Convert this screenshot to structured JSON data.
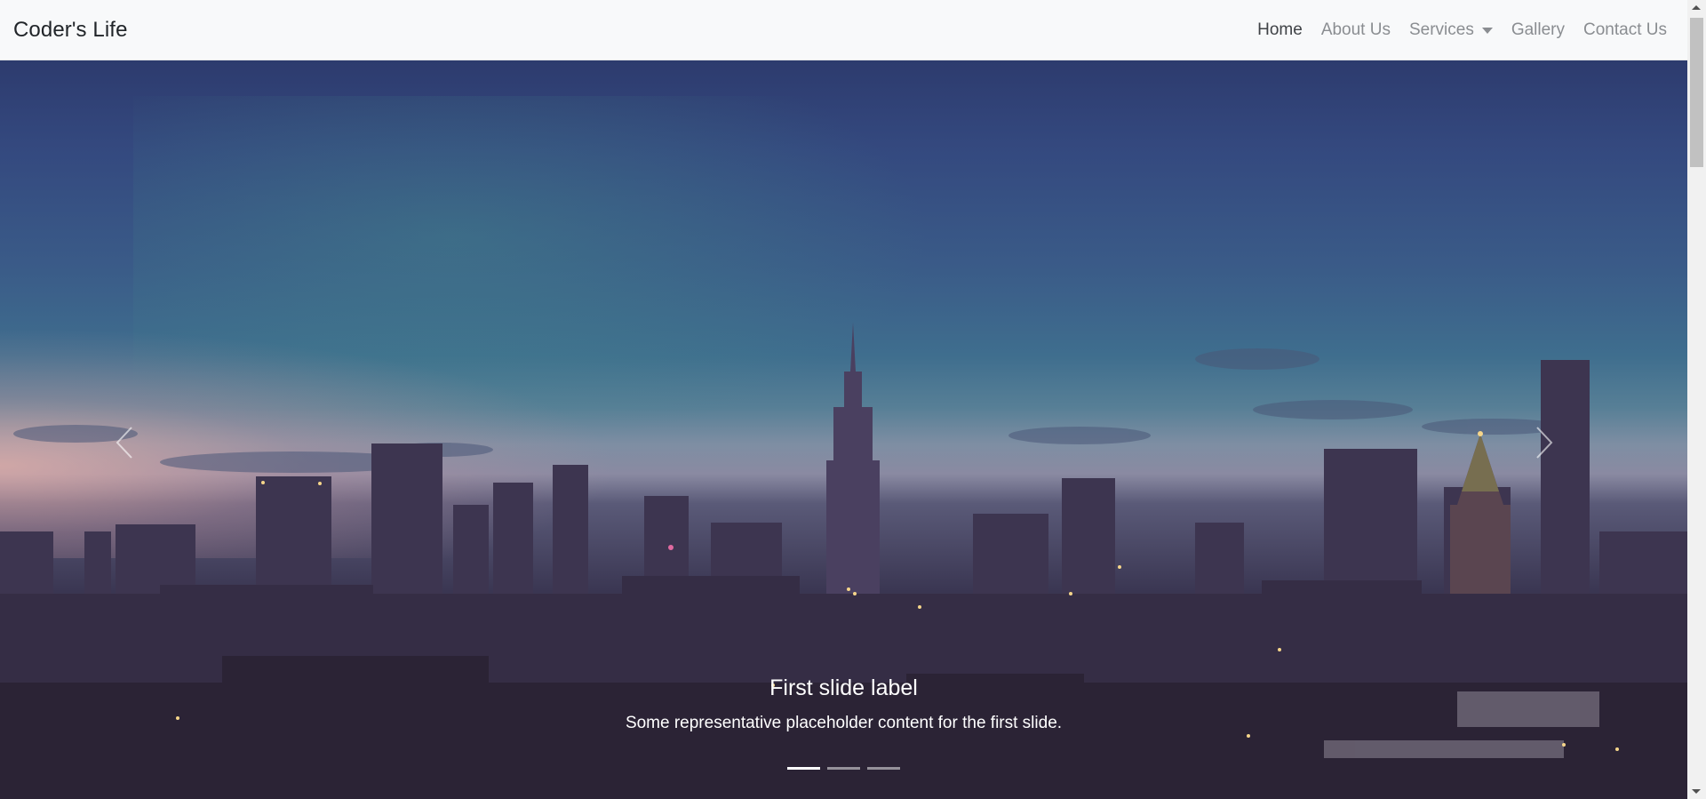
{
  "navbar": {
    "brand": "Coder's Life",
    "links": [
      {
        "label": "Home",
        "active": true
      },
      {
        "label": "About Us",
        "active": false
      },
      {
        "label": "Services",
        "active": false,
        "dropdown": true
      },
      {
        "label": "Gallery",
        "active": false
      },
      {
        "label": "Contact Us",
        "active": false
      }
    ]
  },
  "carousel": {
    "caption_title": "First slide label",
    "caption_text": "Some representative placeholder content for the first slide.",
    "slide_count": 3,
    "active_slide": 1,
    "prev_icon": "chevron-left-icon",
    "next_icon": "chevron-right-icon"
  },
  "colors": {
    "navbar_bg": "#f8f9fa",
    "nav_active": "#3f4246",
    "nav_inactive": "#8a8d91",
    "caption_text": "#ffffff"
  }
}
